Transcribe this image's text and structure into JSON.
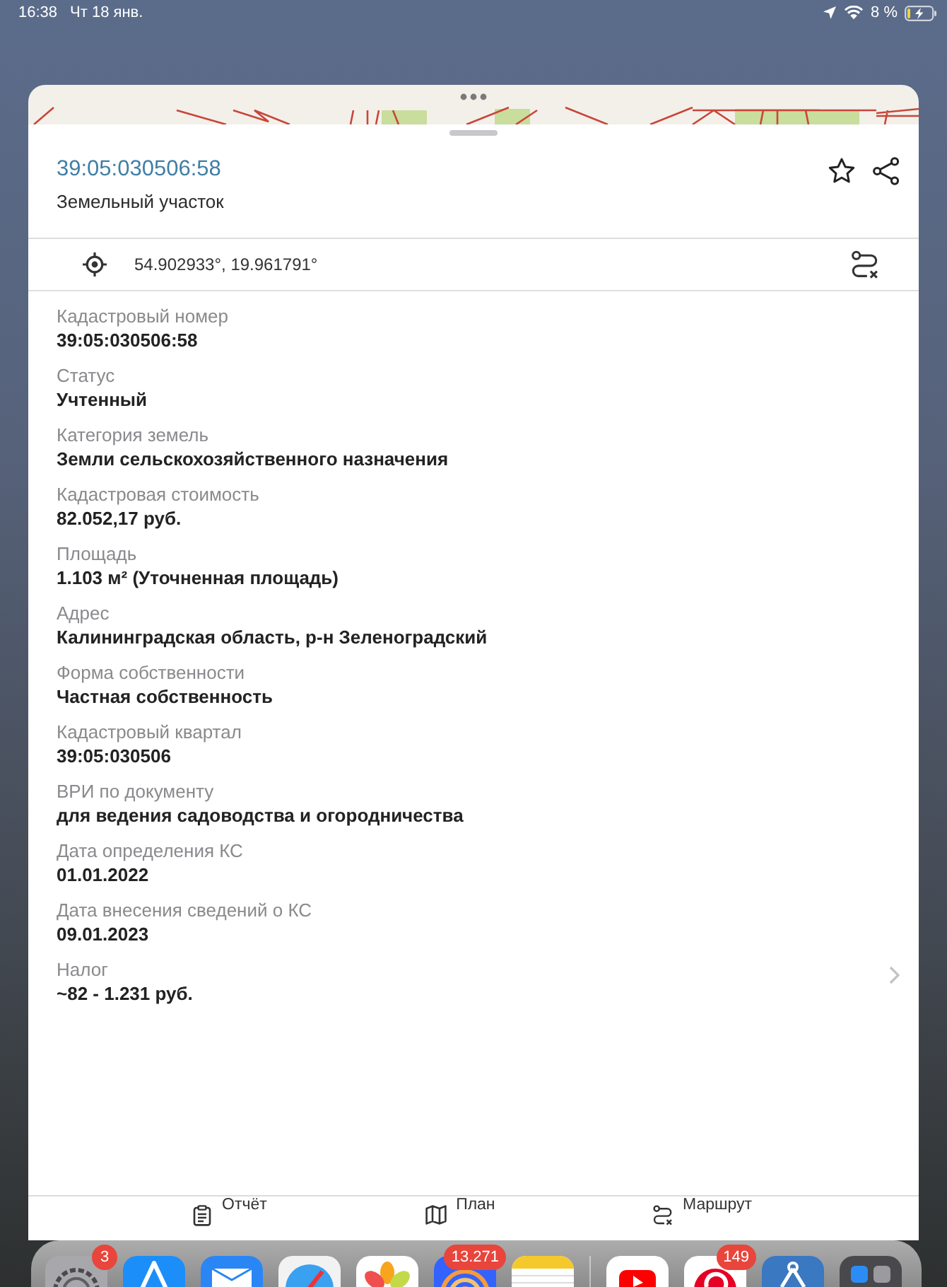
{
  "status_bar": {
    "time": "16:38",
    "date": "Чт 18 янв.",
    "battery": "8 %"
  },
  "sheet": {
    "title": "39:05:030506:58",
    "subtitle": "Земельный участок"
  },
  "coordinates": {
    "value": "54.902933°, 19.961791°"
  },
  "fields": [
    {
      "label": "Кадастровый номер",
      "value": "39:05:030506:58",
      "opens_detail": false
    },
    {
      "label": "Статус",
      "value": "Учтенный",
      "opens_detail": false
    },
    {
      "label": "Категория земель",
      "value": "Земли сельскохозяйственного назначения",
      "opens_detail": false
    },
    {
      "label": "Кадастровая стоимость",
      "value": "82.052,17 руб.",
      "opens_detail": false
    },
    {
      "label": "Площадь",
      "value": "1.103 м² (Уточненная площадь)",
      "opens_detail": false
    },
    {
      "label": "Адрес",
      "value": "Калининградская область, р-н Зеленоградский",
      "opens_detail": false
    },
    {
      "label": "Форма собственности",
      "value": "Частная собственность",
      "opens_detail": false
    },
    {
      "label": "Кадастровый квартал",
      "value": "39:05:030506",
      "opens_detail": false
    },
    {
      "label": "ВРИ по документу",
      "value": "для ведения садоводства и огородничества",
      "opens_detail": false
    },
    {
      "label": "Дата определения КС",
      "value": "01.01.2022",
      "opens_detail": false
    },
    {
      "label": "Дата внесения сведений о КС",
      "value": "09.01.2023",
      "opens_detail": false
    },
    {
      "label": "Налог",
      "value": "~82 - 1.231 руб.",
      "opens_detail": true
    }
  ],
  "toolbar": [
    {
      "kind": "report",
      "label": "Отчёт"
    },
    {
      "kind": "plan",
      "label": "План"
    },
    {
      "kind": "route",
      "label": "Маршрут"
    }
  ],
  "dock": {
    "apps": [
      {
        "kind": "settings",
        "badge": "3"
      },
      {
        "kind": "store"
      },
      {
        "kind": "mail"
      },
      {
        "kind": "browser"
      },
      {
        "kind": "photos"
      },
      {
        "kind": "rings",
        "badge": "13.271"
      },
      {
        "kind": "notes"
      }
    ],
    "recent": [
      {
        "kind": "video"
      },
      {
        "kind": "pin",
        "badge": "149"
      },
      {
        "kind": "compass"
      },
      {
        "kind": "folder"
      }
    ]
  }
}
